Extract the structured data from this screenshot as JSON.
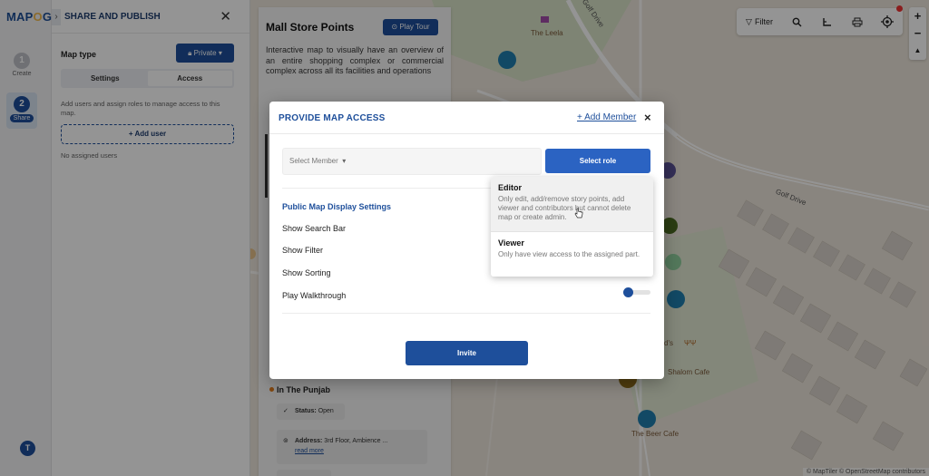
{
  "app": {
    "logo_text": "MAPOG"
  },
  "rail": {
    "steps": [
      {
        "num": "1",
        "label": "Create"
      },
      {
        "num": "2",
        "label": "Share"
      }
    ],
    "avatar": "T"
  },
  "panel": {
    "title": "SHARE AND PUBLISH",
    "map_type_label": "Map type",
    "privacy_button": "Private",
    "tabs": [
      {
        "label": "Settings"
      },
      {
        "label": "Access"
      }
    ],
    "description": "Add users and assign roles to manage access to this map.",
    "add_user": "+ Add user",
    "no_users": "No assigned users"
  },
  "store": {
    "title": "Mall Store Points",
    "play_tour": "Play Tour",
    "description": "Interactive map to visually have an overview of an entire shopping complex or commercial complex across all its facilities and operations",
    "item": {
      "name": "In The Punjab",
      "status_key": "Status:",
      "status_value": "Open",
      "address_key": "Address:",
      "address_value": "3rd Floor, Ambience ...",
      "read_more": "read more"
    }
  },
  "map": {
    "labels": {
      "leela": "The Leela",
      "golf1": "Golf Drive",
      "golf2": "Golf Drive",
      "shalom": "Shalom Cafe",
      "beer": "The Beer Cafe",
      "ds": "d's"
    },
    "attribution": "© MapTiler © OpenStreetMap contributors",
    "toolbar": {
      "filter": "Filter"
    },
    "zoom": {
      "in": "+",
      "out": "−",
      "north": "▲"
    },
    "colors": {
      "pin_blue": "#1f7fae",
      "pin_olive": "#4a6a22",
      "pin_mint": "#8fcf9e",
      "pin_purple": "#5a5296",
      "pin_brown": "#8a6a1a"
    }
  },
  "modal": {
    "title": "PROVIDE MAP ACCESS",
    "add_member": "+ Add Member",
    "close": "×",
    "select_member_placeholder": "Select Member",
    "select_role": "Select role",
    "settings_title": "Public Map Display Settings",
    "settings": [
      {
        "label": "Show Search Bar"
      },
      {
        "label": "Show Filter"
      },
      {
        "label": "Show Sorting"
      },
      {
        "label": "Play Walkthrough"
      }
    ],
    "invite": "Invite"
  },
  "role_menu": {
    "options": [
      {
        "name": "Editor",
        "desc": "Only edit, add/remove story points, add viewer and contributors but cannot delete map or create admin."
      },
      {
        "name": "Viewer",
        "desc": "Only have view access to the assigned part."
      }
    ]
  }
}
